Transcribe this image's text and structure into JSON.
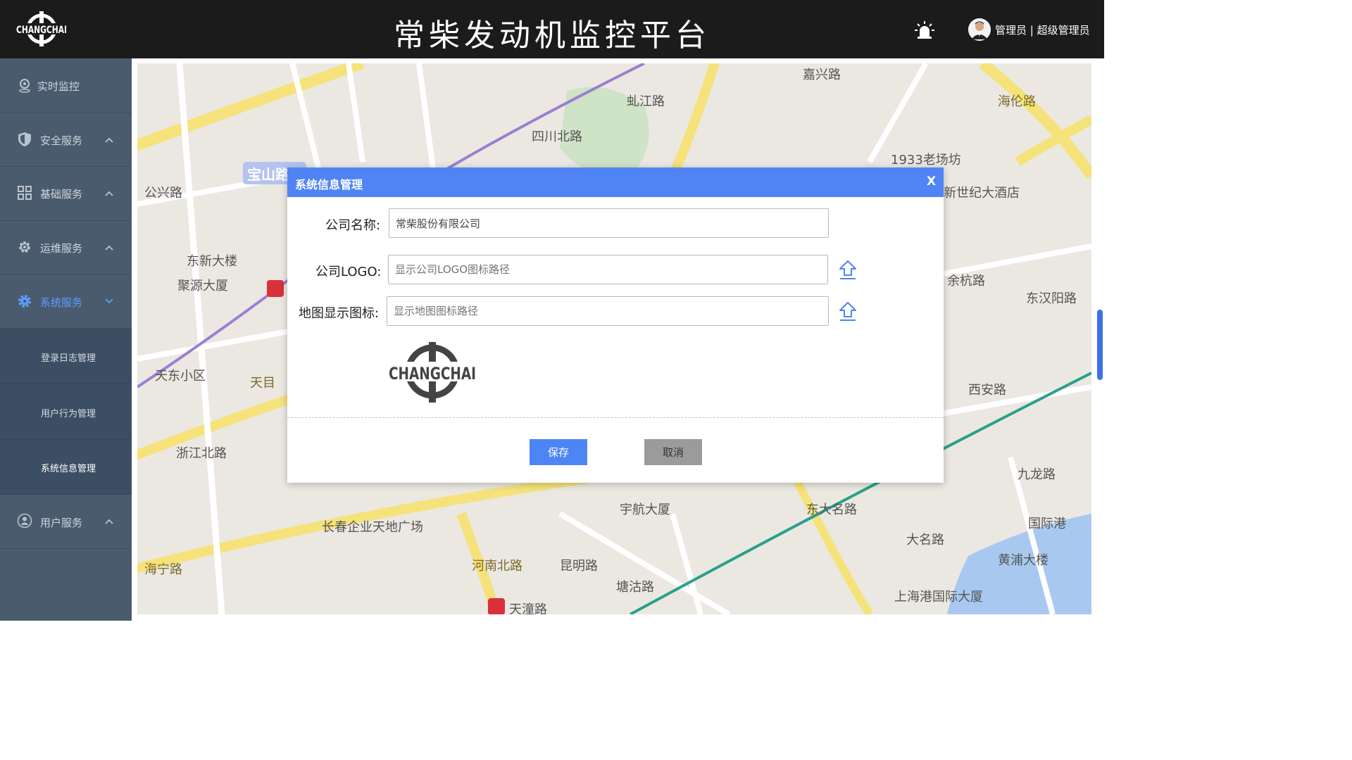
{
  "header": {
    "logo_text": "CHANGCHAI",
    "title": "常柴发动机监控平台",
    "user_text": "管理员 | 超级管理员"
  },
  "sidebar": {
    "items": [
      {
        "label": "实时监控",
        "icon": "location-icon",
        "expanded": null
      },
      {
        "label": "安全服务",
        "icon": "shield-icon",
        "expanded": false
      },
      {
        "label": "基础服务",
        "icon": "grid-icon",
        "expanded": false
      },
      {
        "label": "运维服务",
        "icon": "gear-icon",
        "expanded": false
      },
      {
        "label": "系统服务",
        "icon": "gear-icon",
        "expanded": true
      },
      {
        "label": "用户服务",
        "icon": "user-icon",
        "expanded": false
      }
    ],
    "subitems": [
      {
        "label": "登录日志管理"
      },
      {
        "label": "用户行为管理"
      },
      {
        "label": "系统信息管理",
        "active": true
      }
    ]
  },
  "map": {
    "labels": [
      "宝山路",
      "东新大楼",
      "聚源大厦",
      "天东小区",
      "天目",
      "浙江北路",
      "公兴路",
      "长春企业天地广场",
      "海宁路",
      "四川北路",
      "虬江路",
      "1933老场坊",
      "余杭路",
      "西安路",
      "宇航大厦",
      "大名路",
      "黄浦大楼",
      "国际港",
      "上海港国际大厦",
      "天潼路",
      "河南北路",
      "塘沽路",
      "昆明路",
      "东大名路",
      "海伦路",
      "九龙路",
      "嘉兴路",
      "东汉阳路",
      "新世纪大酒店"
    ]
  },
  "modal": {
    "title": "系统信息管理",
    "close": "X",
    "company_name_label": "公司名称:",
    "company_name_value": "常柴股份有限公司",
    "logo_label": "公司LOGO:",
    "logo_placeholder": "显示公司LOGO图标路径",
    "map_icon_label": "地图显示图标:",
    "map_icon_placeholder": "显示地图图标路径",
    "preview_logo_text": "CHANGCHAI",
    "save_label": "保存",
    "cancel_label": "取消"
  },
  "colors": {
    "header_bg": "#1b1b1b",
    "sidebar_bg": "#4a5b6e",
    "sidebar_sub_bg": "#3c4e63",
    "active_text": "#5b9dff",
    "modal_header": "#5084f5",
    "save_button": "#4d85f5",
    "cancel_button": "#9b9b9b"
  }
}
